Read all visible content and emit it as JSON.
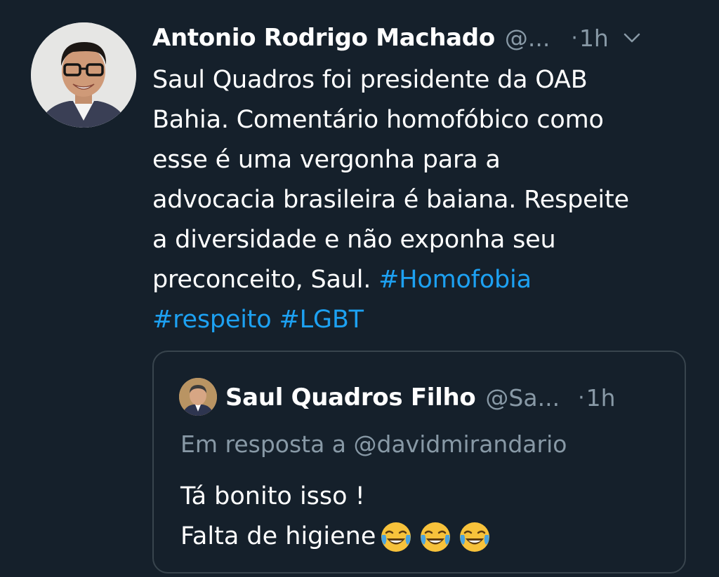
{
  "tweet": {
    "author_name": "Antonio Rodrigo Machado",
    "author_handle": "@...",
    "separator": "·",
    "time": "1h",
    "icons": {
      "avatar": "person-avatar",
      "menu": "chevron-down-icon"
    },
    "text_lines": [
      "Saul Quadros foi presidente da OAB",
      "Bahia. Comentário homofóbico como",
      "esse é uma vergonha para a",
      "advocacia brasileira é baiana. Respeite",
      "a diversidade e não exponha seu"
    ],
    "text_last_line_plain": "preconceito, Saul. ",
    "hashtags": [
      "#Homofobia",
      "#respeito",
      "#LGBT"
    ]
  },
  "quote": {
    "author_name": "Saul Quadros Filho",
    "author_handle": "@Sa...",
    "separator": "·",
    "time": "1h",
    "reply_to": "Em resposta a @davidmirandario",
    "text_line_1": "Tá bonito isso !",
    "text_line_2": "Falta de higiene",
    "emojis": [
      "face-with-tears-of-joy-icon",
      "face-with-tears-of-joy-icon",
      "face-with-tears-of-joy-icon"
    ]
  },
  "colors": {
    "background": "#15202b",
    "text": "#ffffff",
    "secondary": "#8899a6",
    "link": "#1da1f2",
    "border": "#38444d"
  }
}
